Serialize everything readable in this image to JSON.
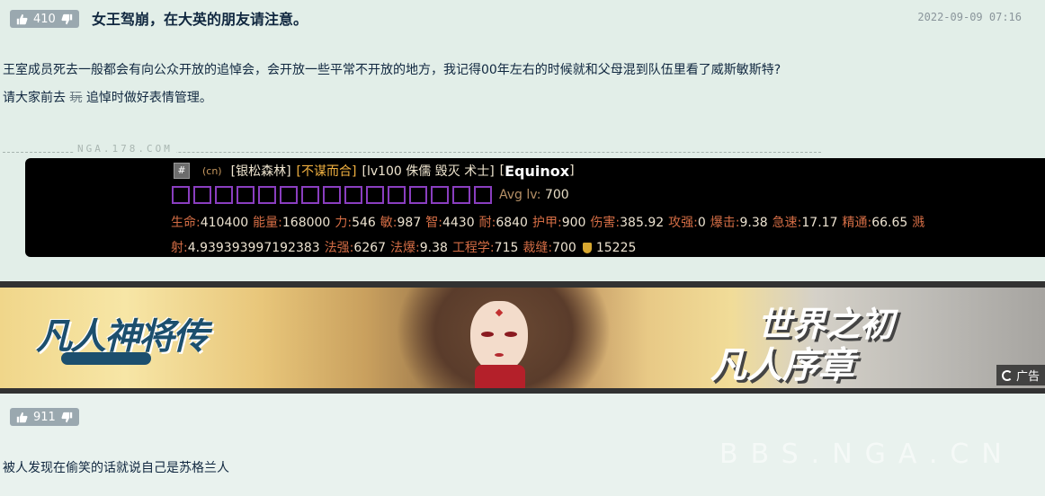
{
  "post1": {
    "likes": "410",
    "title": "女王驾崩，在大英的朋友请注意。",
    "date": "2022-09-09 07:16",
    "line1": "王室成员死去一般都会有向公众开放的追悼会，会开放一些平常不开放的地方，我记得00年左右的时候就和父母混到队伍里看了威斯敏斯特?",
    "line2_before": "请大家前去 ",
    "line2_strike": "玩",
    "line2_after": " 追悼时做好表情管理。",
    "watermark": "NGA.178.COM"
  },
  "character": {
    "hash": "#",
    "region": "(cn)",
    "realm": "[银松森林]",
    "guild": "[不谋而合]",
    "level_info": "[lv100 侏儒 毁灭 术士]",
    "name_open": "[",
    "name": "Equinox",
    "name_close": "]",
    "slot_count": 15,
    "avg_label": "Avg lv:",
    "avg_value": "700",
    "stats": [
      {
        "k": "生命:",
        "v": "410400"
      },
      {
        "k": "能量:",
        "v": "168000"
      },
      {
        "k": "力:",
        "v": "546"
      },
      {
        "k": "敏:",
        "v": "987"
      },
      {
        "k": "智:",
        "v": "4430"
      },
      {
        "k": "耐:",
        "v": "6840"
      },
      {
        "k": "护甲:",
        "v": "900"
      },
      {
        "k": "伤害:",
        "v": "385.92"
      },
      {
        "k": "攻强:",
        "v": "0"
      },
      {
        "k": "爆击:",
        "v": "9.38"
      },
      {
        "k": "急速:",
        "v": "17.17"
      },
      {
        "k": "精通:",
        "v": "66.65"
      },
      {
        "k": "溅射:",
        "v": "4.939393997192383"
      },
      {
        "k": "法强:",
        "v": "6267"
      },
      {
        "k": "法爆:",
        "v": "9.38"
      },
      {
        "k": "工程学:",
        "v": "715"
      },
      {
        "k": "裁缝:",
        "v": "700"
      }
    ],
    "gold_value": "15225"
  },
  "banner": {
    "logo_text": "凡人神将传",
    "slogan_line1": "世界之初",
    "slogan_line2": "凡人序章",
    "ad_label": "广告"
  },
  "post2": {
    "likes": "911",
    "text": "被人发现在偷笑的话就说自己是苏格兰人",
    "watermark": "BBS.NGA.CN"
  }
}
